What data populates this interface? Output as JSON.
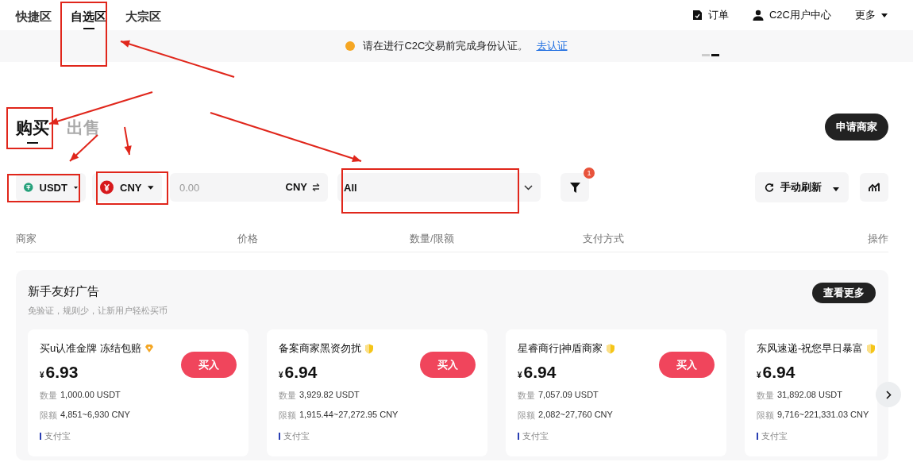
{
  "nav": {
    "tabs": [
      {
        "label": "快捷区",
        "selected": false
      },
      {
        "label": "自选区",
        "selected": true
      },
      {
        "label": "大宗区",
        "selected": false
      }
    ],
    "links": [
      {
        "kind": "orders",
        "label": "订单"
      },
      {
        "kind": "user",
        "label": "C2C用户中心"
      },
      {
        "kind": "more",
        "label": "更多"
      }
    ]
  },
  "notice": {
    "text": "请在进行C2C交易前完成身份认证。",
    "link": "去认证"
  },
  "trade_tabs": [
    {
      "label": "购买",
      "selected": true
    },
    {
      "label": "出售",
      "selected": false
    }
  ],
  "apply_button": "申请商家",
  "filters": {
    "coin": "USDT",
    "fiat": "CNY",
    "amount_placeholder": "0.00",
    "amount_unit": "CNY",
    "payment": "All",
    "filter_badge": "1",
    "refresh": "手动刷新"
  },
  "table": {
    "columns": [
      "商家",
      "价格",
      "数量/限额",
      "支付方式",
      "操作"
    ]
  },
  "promo": {
    "title": "新手友好广告",
    "subtitle": "免验证，规则少，让新用户轻松买币",
    "more_button": "查看更多",
    "cards": [
      {
        "name": "买u认准金牌 冻结包赔",
        "kind": "diamond",
        "currency": "¥",
        "price": "6.93",
        "qty_label": "数量",
        "qty": "1,000.00 USDT",
        "limit_label": "限额",
        "limit": "4,851~6,930 CNY",
        "payment": "支付宝",
        "button": "买入"
      },
      {
        "name": "备案商家黑资勿扰",
        "kind": "shield",
        "currency": "¥",
        "price": "6.94",
        "qty_label": "数量",
        "qty": "3,929.82 USDT",
        "limit_label": "限额",
        "limit": "1,915.44~27,272.95 CNY",
        "payment": "支付宝",
        "button": "买入"
      },
      {
        "name": "星睿商行|神盾商家",
        "kind": "shield",
        "currency": "¥",
        "price": "6.94",
        "qty_label": "数量",
        "qty": "7,057.09 USDT",
        "limit_label": "限额",
        "limit": "2,082~27,760 CNY",
        "payment": "支付宝",
        "button": "买入"
      },
      {
        "name": "东风速递-祝您早日暴富",
        "kind": "shield",
        "currency": "¥",
        "price": "6.94",
        "qty_label": "数量",
        "qty": "31,892.08 USDT",
        "limit_label": "限额",
        "limit": "9,716~221,331.03 CNY",
        "payment": "支付宝"
      }
    ]
  }
}
